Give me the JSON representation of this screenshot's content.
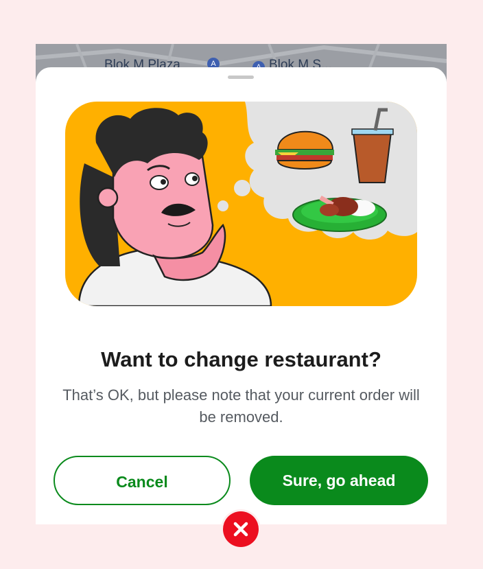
{
  "map": {
    "label_1": "Blok M Plaza",
    "label_2": "Blok M S..."
  },
  "dialog": {
    "title": "Want to change restaurant?",
    "description": "That’s OK, but please note that your current order will be removed.",
    "cancel_label": "Cancel",
    "confirm_label": "Sure, go ahead"
  },
  "icons": {
    "close": "close-icon",
    "illustration": "thinking-man-illustration"
  },
  "colors": {
    "accent": "#0a8a1c",
    "illustration_bg": "#ffb000",
    "close": "#ec0f20"
  }
}
